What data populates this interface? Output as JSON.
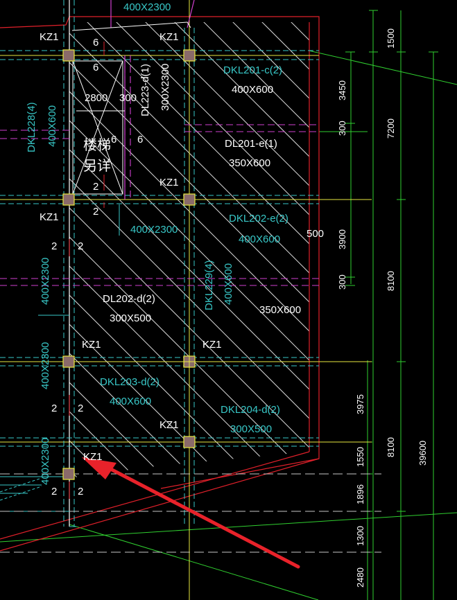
{
  "colors": {
    "background": "#000000",
    "beam_cyan": "#38c8c8",
    "magenta": "#d040d0",
    "red": "#e0202a",
    "yellow": "#e8e840",
    "green": "#30d030",
    "white": "#ffffff",
    "column_fill": "#8a6a6a",
    "arrow": "#e8222a"
  },
  "labels": {
    "top_beam": "400X2300",
    "kz1": "KZ1",
    "num_6": "6",
    "num_2": "2",
    "dim_2800": "2800",
    "dim_300": "300",
    "dl223": "DL223-d(1)",
    "dl223_size": "300X2300",
    "dkl201c": "DKL201-c(2)",
    "dkl201c_size": "400X600",
    "dkl228": "DKL228(4)",
    "dkl228_size": "400X600",
    "stair_1": "楼梯",
    "stair_2": "另详",
    "dl201e": "DL201-e(1)",
    "dl201e_size": "350X600",
    "mid_beam": "400X2300",
    "dkl202e": "DKL202-e(2)",
    "dkl202e_size": "400X600",
    "dim_500": "500",
    "left_beam": "400X2300",
    "dkl229": "DKL229(4)",
    "dkl229_size": "400X600",
    "dl202d": "DL202-d(2)",
    "dl202d_size": "300X500",
    "size_350x600": "350X600",
    "dkl203d": "DKL203-d(2)",
    "dkl203d_size": "400X600",
    "dkl204d": "DKL204-d(2)",
    "dkl204d_size": "300X500"
  },
  "dims": {
    "d1500": "1500",
    "d3450": "3450",
    "d300a": "300",
    "d7200": "7200",
    "d3900": "3900",
    "d300b": "300",
    "d8100a": "8100",
    "d3975": "3975",
    "d1550": "1550",
    "d1896": "1896",
    "d8100b": "8100",
    "d39600": "39600",
    "d1300": "1300",
    "d2480": "2480"
  }
}
